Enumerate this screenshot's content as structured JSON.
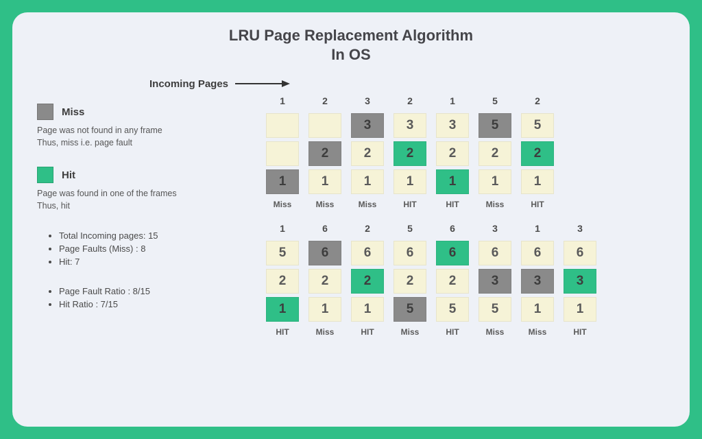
{
  "title_line1": "LRU Page Replacement Algorithm",
  "title_line2": "In OS",
  "incoming_label": "Incoming Pages",
  "legend": {
    "miss": {
      "title": "Miss",
      "desc": "Page was not found in any frame\nThus, miss i.e. page fault"
    },
    "hit": {
      "title": "Hit",
      "desc": "Page was found in one of the frames\nThus, hit"
    }
  },
  "stats_a": [
    "Total Incoming pages:  15",
    "Page Faults (Miss) : 8",
    "Hit: 7"
  ],
  "stats_b": [
    "Page Fault Ratio : 8/15",
    "Hit Ratio : 7/15"
  ],
  "row1": [
    {
      "page": "1",
      "status": "Miss",
      "cells": [
        {
          "v": "",
          "c": "cream"
        },
        {
          "v": "",
          "c": "cream"
        },
        {
          "v": "1",
          "c": "grey"
        }
      ]
    },
    {
      "page": "2",
      "status": "Miss",
      "cells": [
        {
          "v": "",
          "c": "cream"
        },
        {
          "v": "2",
          "c": "grey"
        },
        {
          "v": "1",
          "c": "cream"
        }
      ]
    },
    {
      "page": "3",
      "status": "Miss",
      "cells": [
        {
          "v": "3",
          "c": "grey"
        },
        {
          "v": "2",
          "c": "cream"
        },
        {
          "v": "1",
          "c": "cream"
        }
      ]
    },
    {
      "page": "2",
      "status": "HIT",
      "cells": [
        {
          "v": "3",
          "c": "cream"
        },
        {
          "v": "2",
          "c": "green"
        },
        {
          "v": "1",
          "c": "cream"
        }
      ]
    },
    {
      "page": "1",
      "status": "HIT",
      "cells": [
        {
          "v": "3",
          "c": "cream"
        },
        {
          "v": "2",
          "c": "cream"
        },
        {
          "v": "1",
          "c": "green"
        }
      ]
    },
    {
      "page": "5",
      "status": "Miss",
      "cells": [
        {
          "v": "5",
          "c": "grey"
        },
        {
          "v": "2",
          "c": "cream"
        },
        {
          "v": "1",
          "c": "cream"
        }
      ]
    },
    {
      "page": "2",
      "status": "HIT",
      "cells": [
        {
          "v": "5",
          "c": "cream"
        },
        {
          "v": "2",
          "c": "green"
        },
        {
          "v": "1",
          "c": "cream"
        }
      ]
    }
  ],
  "row2": [
    {
      "page": "1",
      "status": "HIT",
      "cells": [
        {
          "v": "5",
          "c": "cream"
        },
        {
          "v": "2",
          "c": "cream"
        },
        {
          "v": "1",
          "c": "green"
        }
      ]
    },
    {
      "page": "6",
      "status": "Miss",
      "cells": [
        {
          "v": "6",
          "c": "grey"
        },
        {
          "v": "2",
          "c": "cream"
        },
        {
          "v": "1",
          "c": "cream"
        }
      ]
    },
    {
      "page": "2",
      "status": "HIT",
      "cells": [
        {
          "v": "6",
          "c": "cream"
        },
        {
          "v": "2",
          "c": "green"
        },
        {
          "v": "1",
          "c": "cream"
        }
      ]
    },
    {
      "page": "5",
      "status": "Miss",
      "cells": [
        {
          "v": "6",
          "c": "cream"
        },
        {
          "v": "2",
          "c": "cream"
        },
        {
          "v": "5",
          "c": "grey"
        }
      ]
    },
    {
      "page": "6",
      "status": "HIT",
      "cells": [
        {
          "v": "6",
          "c": "green"
        },
        {
          "v": "2",
          "c": "cream"
        },
        {
          "v": "5",
          "c": "cream"
        }
      ]
    },
    {
      "page": "3",
      "status": "Miss",
      "cells": [
        {
          "v": "6",
          "c": "cream"
        },
        {
          "v": "3",
          "c": "grey"
        },
        {
          "v": "5",
          "c": "cream"
        }
      ]
    },
    {
      "page": "1",
      "status": "Miss",
      "cells": [
        {
          "v": "6",
          "c": "cream"
        },
        {
          "v": "3",
          "c": "grey"
        },
        {
          "v": "1",
          "c": "cream"
        }
      ]
    },
    {
      "page": "3",
      "status": "HIT",
      "cells": [
        {
          "v": "6",
          "c": "cream"
        },
        {
          "v": "3",
          "c": "green"
        },
        {
          "v": "1",
          "c": "cream"
        }
      ]
    }
  ]
}
